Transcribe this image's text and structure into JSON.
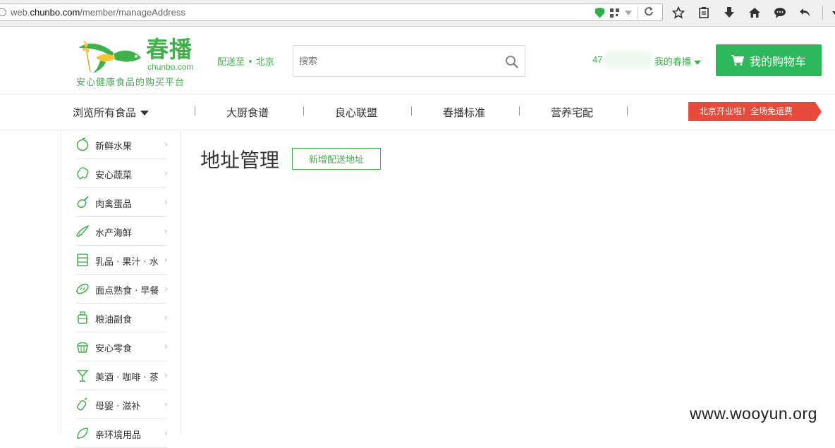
{
  "browser": {
    "url_prefix": "web.",
    "url_host": "chunbo.com",
    "url_path": "/member/manageAddress",
    "reload_glyph": "C"
  },
  "header": {
    "logo_name": "春播",
    "logo_domain": "chunbo.com",
    "slogan": "安心健康食品的购买平台",
    "deliver_to": "配送至 • 北京",
    "search_placeholder": "搜索",
    "user_id_partial": "47",
    "my_account": "我的春播",
    "cart_label": "我的购物车"
  },
  "nav": {
    "browse_all": "浏览所有食品",
    "items": [
      "大厨食谱",
      "良心联盟",
      "春播标准",
      "营养宅配"
    ],
    "promo": "北京开业啦！全场免运费"
  },
  "sidebar": {
    "categories": [
      {
        "label": "新鲜水果",
        "icon": "fruit-icon"
      },
      {
        "label": "安心蔬菜",
        "icon": "vegetable-icon"
      },
      {
        "label": "肉禽蛋品",
        "icon": "meat-icon"
      },
      {
        "label": "水产海鲜",
        "icon": "seafood-icon"
      },
      {
        "label": "乳品 · 果汁 · 水",
        "icon": "dairy-icon"
      },
      {
        "label": "面点熟食 · 早餐",
        "icon": "bread-icon"
      },
      {
        "label": "粮油副食",
        "icon": "grain-oil-icon"
      },
      {
        "label": "安心零食",
        "icon": "snack-icon"
      },
      {
        "label": "美酒 · 咖啡 · 茶",
        "icon": "drinks-icon"
      },
      {
        "label": "母婴 · 滋补",
        "icon": "baby-icon"
      },
      {
        "label": "亲环境用品",
        "icon": "eco-icon"
      }
    ],
    "chevron": "›"
  },
  "main": {
    "title": "地址管理",
    "add_button": "新增配送地址"
  },
  "watermark": "www.wooyun.org",
  "colors": {
    "brand_green": "#3fb04a",
    "cart_green": "#2db85c",
    "promo_red": "#e64b3c"
  }
}
